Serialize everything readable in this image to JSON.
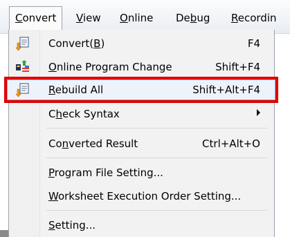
{
  "menubar": {
    "items": [
      {
        "pre": "",
        "acc": "C",
        "post": "onvert"
      },
      {
        "pre": "",
        "acc": "V",
        "post": "iew"
      },
      {
        "pre": "",
        "acc": "O",
        "post": "nline"
      },
      {
        "pre": "De",
        "acc": "b",
        "post": "ug"
      },
      {
        "pre": "",
        "acc": "R",
        "post": "ecordin"
      }
    ]
  },
  "menu": {
    "convert": {
      "pre": "Convert(",
      "acc": "B",
      "post": ")",
      "shortcut": "F4",
      "icon": "convert-icon"
    },
    "online": {
      "pre": "",
      "acc": "O",
      "post": "nline Program Change",
      "shortcut": "Shift+F4",
      "icon": "online-program-change-icon"
    },
    "rebuild": {
      "pre": "",
      "acc": "R",
      "post": "ebuild All",
      "shortcut": "Shift+Alt+F4",
      "icon": "rebuild-all-icon"
    },
    "check": {
      "pre": "C",
      "acc": "h",
      "post": "eck Syntax",
      "submenu_icon": "submenu-arrow-icon"
    },
    "converted": {
      "pre": "Co",
      "acc": "n",
      "post": "verted Result",
      "shortcut": "Ctrl+Alt+O"
    },
    "programfile": {
      "pre": "",
      "acc": "P",
      "post": "rogram File Setting..."
    },
    "worksheet": {
      "pre": "",
      "acc": "W",
      "post": "orksheet Execution Order Setting..."
    },
    "setting": {
      "pre": "",
      "acc": "S",
      "post": "etting..."
    }
  },
  "colors": {
    "highlight_border": "#e00000",
    "hover_border": "#8fa9d8",
    "menu_background": "#f2f2f2"
  }
}
